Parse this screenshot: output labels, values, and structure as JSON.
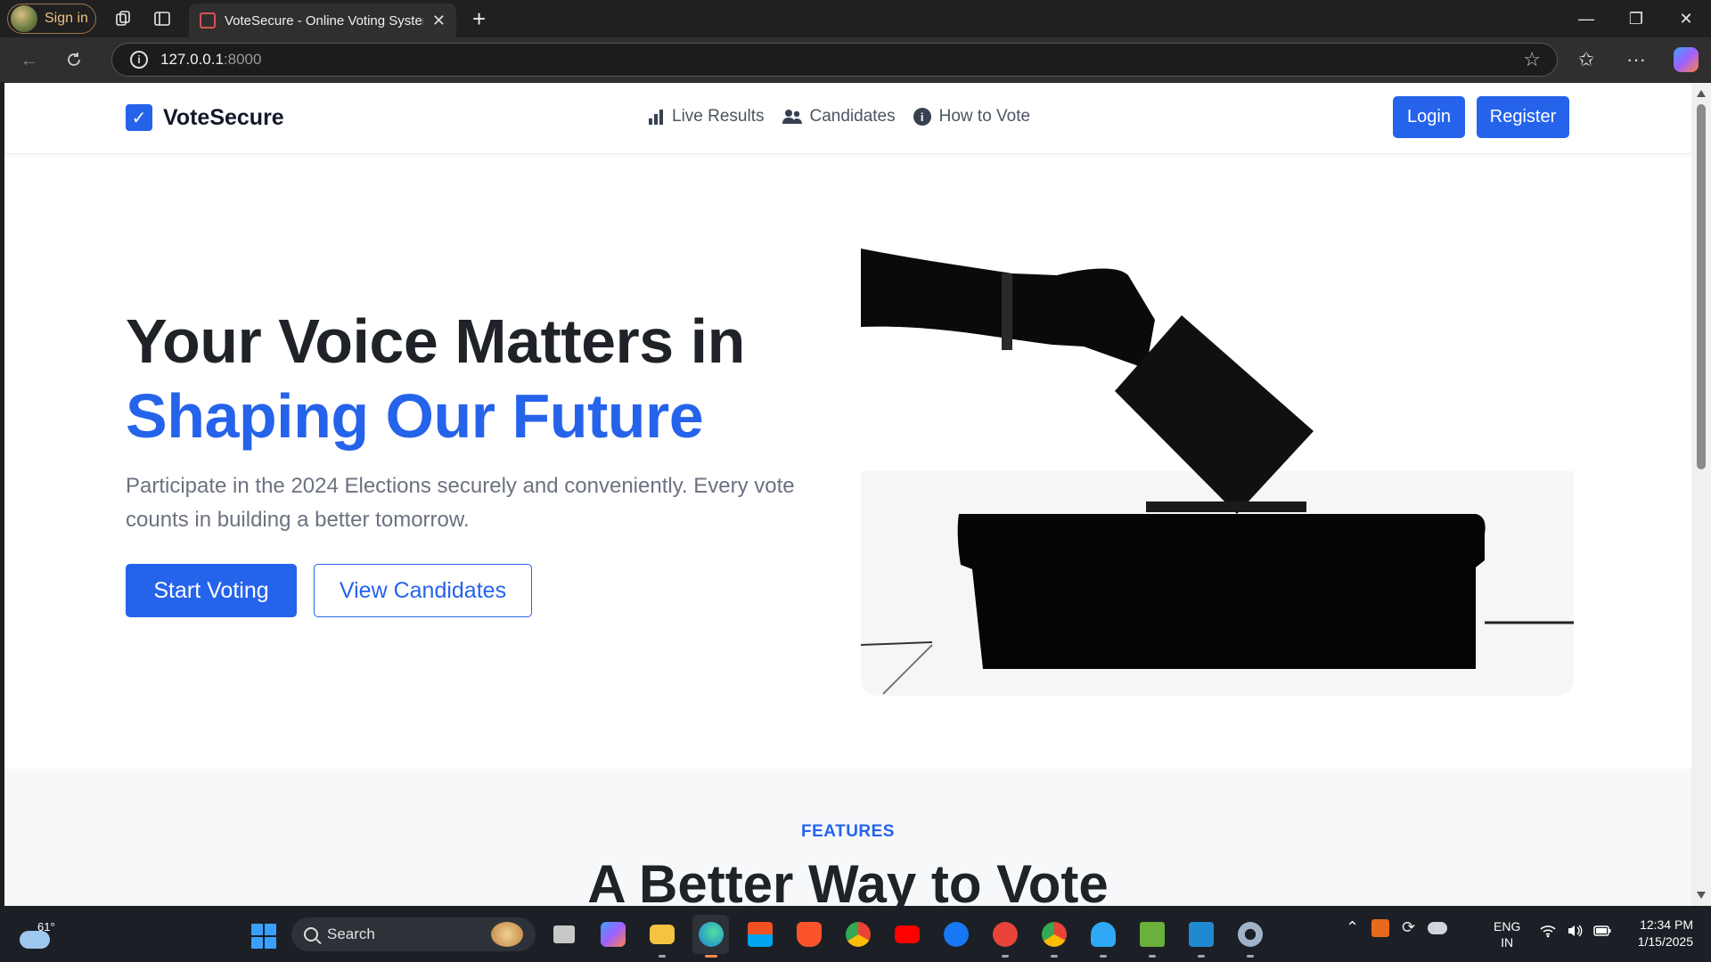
{
  "browser": {
    "profile_label": "Sign in",
    "tab_title": "VoteSecure - Online Voting System",
    "new_tab_symbol": "+",
    "url_host": "127.0.0.1",
    "url_port": ":8000"
  },
  "site": {
    "brand": "VoteSecure",
    "nav": {
      "live_results": "Live Results",
      "candidates": "Candidates",
      "how_to_vote": "How to Vote",
      "login": "Login",
      "register": "Register"
    },
    "hero": {
      "title_line1": "Your Voice Matters in",
      "title_line2": "Shaping Our Future",
      "subtitle": "Participate in the 2024 Elections securely and conveniently. Every vote counts in building a better tomorrow.",
      "start_voting": "Start Voting",
      "view_candidates": "View Candidates"
    },
    "features": {
      "label": "FEATURES",
      "title": "A Better Way to Vote"
    },
    "colors": {
      "accent": "#2563eb",
      "heading": "#1f2328",
      "muted": "#6b7280"
    }
  },
  "taskbar": {
    "weather_temp": "61°",
    "search_label": "Search",
    "lang_line1": "ENG",
    "lang_line2": "IN",
    "time": "12:34 PM",
    "date": "1/15/2025"
  }
}
